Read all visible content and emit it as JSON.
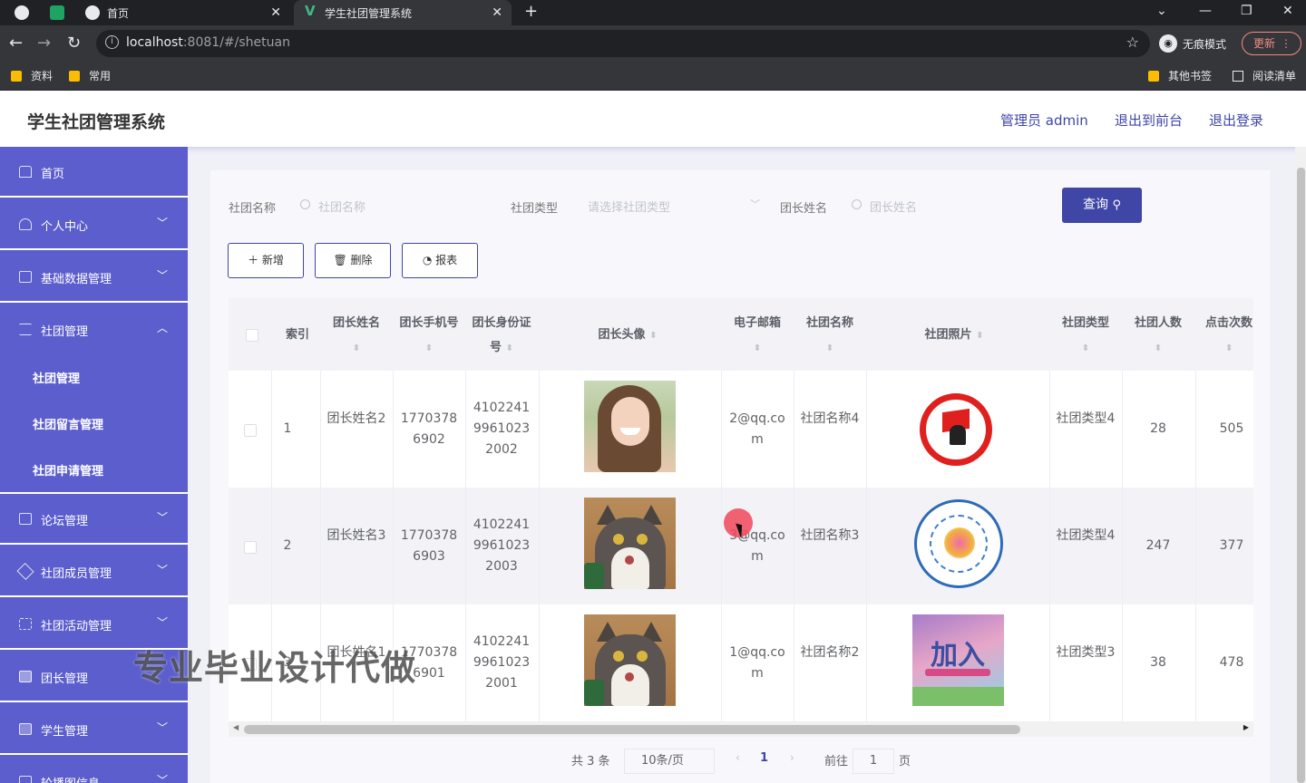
{
  "browser": {
    "tabs": [
      {
        "title": "首页"
      },
      {
        "title": "学生社团管理系统"
      }
    ],
    "url_host": "localhost",
    "url_rest": ":8081/#/shetuan",
    "incognito_label": "无痕模式",
    "update_label": "更新",
    "bookmarks": [
      "资料",
      "常用"
    ],
    "bookmarks_right": [
      "其他书签",
      "阅读清单"
    ]
  },
  "header": {
    "title": "学生社团管理系统",
    "links": [
      "管理员 admin",
      "退出到前台",
      "退出登录"
    ]
  },
  "sidebar": {
    "items": [
      {
        "label": "首页"
      },
      {
        "label": "个人中心"
      },
      {
        "label": "基础数据管理"
      },
      {
        "label": "社团管理"
      },
      {
        "label": "论坛管理"
      },
      {
        "label": "社团成员管理"
      },
      {
        "label": "社团活动管理"
      },
      {
        "label": "团长管理"
      },
      {
        "label": "学生管理"
      },
      {
        "label": "轮播图信息"
      }
    ],
    "submenu": [
      "社团管理",
      "社团留言管理",
      "社团申请管理"
    ]
  },
  "filters": {
    "club_name_label": "社团名称",
    "club_name_placeholder": "社团名称",
    "club_type_label": "社团类型",
    "club_type_placeholder": "请选择社团类型",
    "leader_name_label": "团长姓名",
    "leader_name_placeholder": "团长姓名",
    "query_label": "查询"
  },
  "actions": {
    "add_label": "新增",
    "delete_label": "删除",
    "report_label": "报表"
  },
  "table": {
    "headers": {
      "index": "索引",
      "leader_name": "团长姓名",
      "leader_phone": "团长手机号",
      "leader_id": "团长身份证号",
      "leader_avatar": "团长头像",
      "email": "电子邮箱",
      "club_name": "社团名称",
      "club_photo": "社团照片",
      "club_type": "社团类型",
      "members": "社团人数",
      "clicks": "点击次数"
    },
    "rows": [
      {
        "index": "1",
        "leader_name": "团长姓名2",
        "phone": "17703786902",
        "id_no": "410224199610232002",
        "email": "2@qq.com",
        "club_name": "社团名称4",
        "club_type": "社团类型4",
        "members": "28",
        "clicks": "505"
      },
      {
        "index": "2",
        "leader_name": "团长姓名3",
        "phone": "17703786903",
        "id_no": "410224199610232003",
        "email": "3@qq.com",
        "club_name": "社团名称3",
        "club_type": "社团类型4",
        "members": "247",
        "clicks": "377"
      },
      {
        "index": "3",
        "leader_name": "团长姓名1",
        "phone": "17703786901",
        "id_no": "410224199610232001",
        "email": "1@qq.com",
        "club_name": "社团名称2",
        "club_type": "社团类型3",
        "members": "38",
        "clicks": "478"
      }
    ]
  },
  "pagination": {
    "total": "共 3 条",
    "page_size": "10条/页",
    "current_page": "1",
    "goto_label": "前往",
    "goto_value": "1",
    "page_suffix": "页"
  },
  "watermark": "专业毕业设计代做"
}
